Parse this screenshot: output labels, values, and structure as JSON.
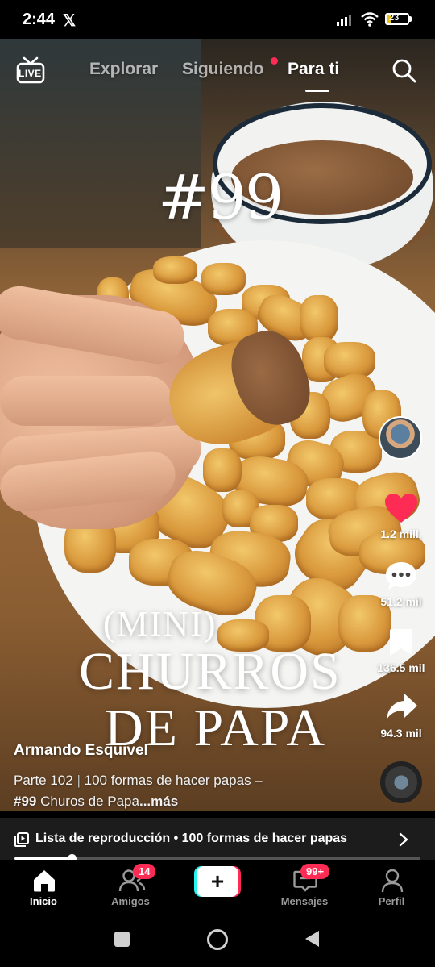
{
  "status_bar": {
    "time": "2:44",
    "app_icon": "x-logo",
    "battery": "23"
  },
  "top_nav": {
    "live_label": "LIVE",
    "tabs": [
      {
        "label": "Explorar",
        "active": false
      },
      {
        "label": "Siguiendo",
        "active": false,
        "has_dot": true
      },
      {
        "label": "Para ti",
        "active": true
      }
    ],
    "search_icon": "search-icon"
  },
  "video": {
    "overlay_number": "#99",
    "overlay_title_line1": "(MINI)",
    "overlay_title_line2": "CHURROS",
    "overlay_title_line3": "DE PAPA"
  },
  "actions": {
    "likes": "1.2 mill.",
    "comments": "51.2 mil",
    "saves": "136.5 mil",
    "shares": "94.3 mil"
  },
  "caption": {
    "author": "Armando Esquivel",
    "line1_part": "Parte 102",
    "line1_sep": "|",
    "line1_rest": "100 formas de hacer papas –",
    "line2_tag": "#99",
    "line2_text": " Churos de Papa",
    "more": "...más"
  },
  "playlist": {
    "label": "Lista de reproducción • 100 formas de hacer papas",
    "progress": 0.14
  },
  "bottom_nav": {
    "items": [
      {
        "label": "Inicio",
        "icon": "home-icon",
        "active": true
      },
      {
        "label": "Amigos",
        "icon": "friends-icon",
        "badge": "14"
      },
      {
        "label": "",
        "icon": "create-icon"
      },
      {
        "label": "Mensajes",
        "icon": "inbox-icon",
        "badge": "99+"
      },
      {
        "label": "Perfil",
        "icon": "profile-icon"
      }
    ]
  },
  "colors": {
    "accent_red": "#fe2c55",
    "accent_cyan": "#25f4ee"
  }
}
